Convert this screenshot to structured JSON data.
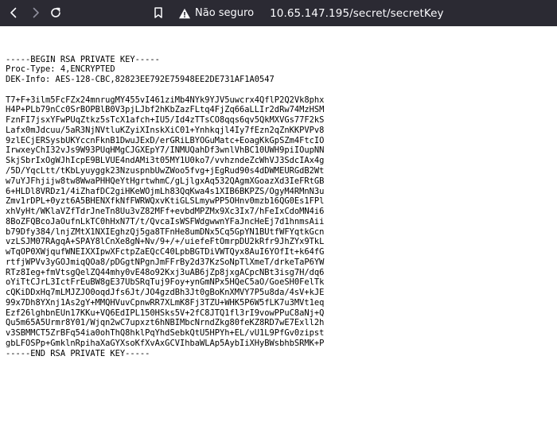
{
  "browser": {
    "security_label": "Não seguro",
    "url": "10.65.147.195/secret/secretKey",
    "colors": {
      "toolbar_bg": "#2b2a33",
      "text": "#fbfbfe"
    },
    "icons": [
      "back-arrow-icon",
      "forward-arrow-icon",
      "reload-icon",
      "bookmark-icon",
      "warning-icon"
    ]
  },
  "document": {
    "lines": [
      "-----BEGIN RSA PRIVATE KEY-----",
      "Proc-Type: 4,ENCRYPTED",
      "DEK-Info: AES-128-CBC,82823EE792E75948EE2DE731AF1A0547",
      "",
      "T7+F+3ilm5FcFZx24mnrugMY455vI461ziMb4NYk9YJV5uwcrx4QflP2Q2Vk8phx",
      "H4P+PLb79nCc0SrBOPBlB0V3pjLJbf2hKbZazFLtq4FjZq66aLLIr2dRw74MzHSM",
      "FznFI7jsxYFwPUqZtkz5sTcX1afch+IU5/Id4zTTsCO8qqs6qv5QkMXVGs77F2kS",
      "Lafx0mJdcuu/5aR3NjNVtluKZyiXInskXiC01+Ynhkqjl4Iy7fEzn2qZnKKPVPv8",
      "9zlECjERSysbUKYccnFknB1DwuJExD/erGRiLBYOGuMatc+EoagKkGpSZm4FtcIO",
      "IrwxeyChI32vJs9W93PUqHMgCJGXEpY7/INMUQahDf3wnlVhBC10UWH9piIOupNN",
      "SkjSbrIxOgWJhIcpE9BLVUE4ndAMi3t05MY1U0ko7/vvhzndeZcWhVJ3SdcIAx4g",
      "/5D/YqcLtt/tKbLyuyggk23NzuspnbUwZWoo5fvg+jEgRud90s4dDWMEURGdB2Wt",
      "w7uYJFhjijw8tw8WwaPHHQeYtHgrtwhmC/gLjlgxAq532QAgmXGoazXd3IeFRtGB",
      "6+HLDl8VRDz1/4iZhafDC2giHKeWOjmLh83QqKwa4s1XIB6BKPZS/OgyM4RMnN3u",
      "Zmv1rDPL+0yzt6A5BHENXfkNfFWRWQxvKtiGLSLmywPP5OHnv0mzb16QG0Es1FPl",
      "xhVyHt/WKlaVZfTdrJneTn8Uu3vZ82MFf+evbdMPZMx9Xc3Ix7/hFeIxCdoMN4i6",
      "8BoZFQBcoJaOufnLkTC0hHxN7T/t/QvcaIsWSFWdgwwnYFaJncHeEj7d1hnmsAii",
      "b79Dfy384/lnjZMtX1NXIEghzQj5ga8TFnHe8umDNx5Cq5GpYN1BUtfWFYqtkGcn",
      "vzLSJM07RAgqA+SPAY8lCnXe8gN+Nv/9+/+/uiefeFtOmrpDU2kRfr9JhZYx9TkL",
      "wTqOP0XWjqufWNEIXXIpwXFctpZaEQcC40LpbBGTDiVWTQyx8AuI6YOfIt+k64fG",
      "rtfjWPVv3yGOJmiqQOa8/pDGgtNPgnJmFFrBy2d37KzSoNpTlXmeT/drkeTaP6YW",
      "RTz8Ieg+fmVtsgQelZQ44mhy0vE48o92Kxj3uAB6jZp8jxgACpcNBt3isg7H/dq6",
      "oYiTtCJrL3IctFrEuBW8gE37UbSRqTuj9Foy+ynGmNPx5HQeC5aO/GoeSH0FelTk",
      "cQKiDDxHq7mLMJZJO0oqdJfs6Jt/JO4gzdBh3Jt0gBoKnXMVY7P5u8da/4sV+kJE",
      "99x7Dh8YXnj1As2gY+MMQHVuvCpnwRR7XLmK8Fj3TZU+WHK5P6W5fLK7u3MVt1eq",
      "Ezf26lghbnEUn17KKu+VQ6EdIPL150HSks5V+2fC8JTQ1fl3rI9vowPPuC8aNj+Q",
      "Qu5m65A5Urmr8Y01/Wjqn2wC7upxzt6hNBIMbcNrndZkg80feKZ8RD7wE7Exll2h",
      "v3SBMMCT5ZrBFq54ia0ohThQ8hklPqYhdSebkQtU5HPYh+EL/vU1L9PfGv0zipst",
      "gbLFOSPp+GmklnRpihaXaGYXsoKfXvAxGCVIhbaWLAp5AybIiXHyBWsbhbSRMK+P",
      "-----END RSA PRIVATE KEY-----"
    ]
  }
}
